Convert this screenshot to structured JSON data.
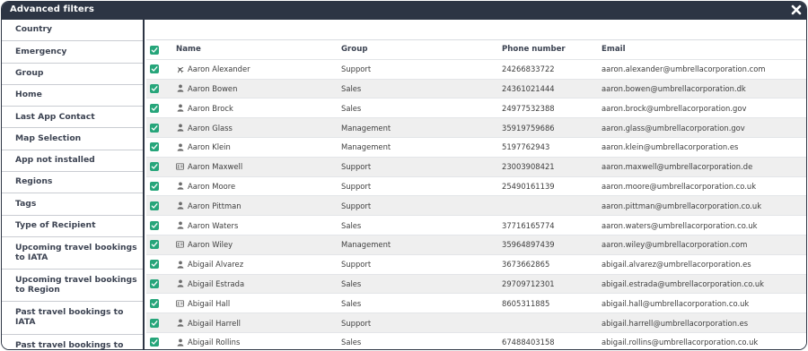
{
  "window": {
    "title": "Advanced filters"
  },
  "sidebar": {
    "items": [
      {
        "label": "Country"
      },
      {
        "label": "Emergency"
      },
      {
        "label": "Group"
      },
      {
        "label": "Home"
      },
      {
        "label": "Last App Contact"
      },
      {
        "label": "Map Selection"
      },
      {
        "label": "App not installed"
      },
      {
        "label": "Regions"
      },
      {
        "label": "Tags"
      },
      {
        "label": "Type of Recipient"
      },
      {
        "label": "Upcoming travel bookings to IATA"
      },
      {
        "label": "Upcoming travel bookings to Region"
      },
      {
        "label": "Past travel bookings to IATA"
      },
      {
        "label": "Past travel bookings to Region"
      }
    ]
  },
  "table": {
    "headers": {
      "name": "Name",
      "group": "Group",
      "phone": "Phone number",
      "email": "Email"
    },
    "rows": [
      {
        "icon": "plane-icon",
        "name": "Aaron Alexander",
        "group": "Support",
        "phone": "24266833722",
        "email": "aaron.alexander@umbrellacorporation.com"
      },
      {
        "icon": "person-icon",
        "name": "Aaron Bowen",
        "group": "Sales",
        "phone": "24361021444",
        "email": "aaron.bowen@umbrellacorporation.dk"
      },
      {
        "icon": "person-icon",
        "name": "Aaron Brock",
        "group": "Sales",
        "phone": "24977532388",
        "email": "aaron.brock@umbrellacorporation.gov"
      },
      {
        "icon": "person-icon",
        "name": "Aaron Glass",
        "group": "Management",
        "phone": "35919759686",
        "email": "aaron.glass@umbrellacorporation.gov"
      },
      {
        "icon": "person-icon",
        "name": "Aaron Klein",
        "group": "Management",
        "phone": "5197762943",
        "email": "aaron.klein@umbrellacorporation.es"
      },
      {
        "icon": "id-card-icon",
        "name": "Aaron Maxwell",
        "group": "Support",
        "phone": "23003908421",
        "email": "aaron.maxwell@umbrellacorporation.de"
      },
      {
        "icon": "person-icon",
        "name": "Aaron Moore",
        "group": "Support",
        "phone": "25490161139",
        "email": "aaron.moore@umbrellacorporation.co.uk"
      },
      {
        "icon": "person-icon",
        "name": "Aaron Pittman",
        "group": "Support",
        "phone": "",
        "email": "aaron.pittman@umbrellacorporation.co.uk"
      },
      {
        "icon": "person-icon",
        "name": "Aaron Waters",
        "group": "Sales",
        "phone": "37716165774",
        "email": "aaron.waters@umbrellacorporation.co.uk"
      },
      {
        "icon": "id-card-icon",
        "name": "Aaron Wiley",
        "group": "Management",
        "phone": "35964897439",
        "email": "aaron.wiley@umbrellacorporation.com"
      },
      {
        "icon": "person-icon",
        "name": "Abigail Alvarez",
        "group": "Support",
        "phone": "3673662865",
        "email": "abigail.alvarez@umbrellacorporation.es"
      },
      {
        "icon": "person-icon",
        "name": "Abigail Estrada",
        "group": "Sales",
        "phone": "29709712301",
        "email": "abigail.estrada@umbrellacorporation.co.uk"
      },
      {
        "icon": "id-card-icon",
        "name": "Abigail Hall",
        "group": "Sales",
        "phone": "8605311885",
        "email": "abigail.hall@umbrellacorporation.co.uk"
      },
      {
        "icon": "person-icon",
        "name": "Abigail Harrell",
        "group": "Support",
        "phone": "",
        "email": "abigail.harrell@umbrellacorporation.es"
      },
      {
        "icon": "person-icon",
        "name": "Abigail Rollins",
        "group": "Sales",
        "phone": "67488403158",
        "email": "abigail.rollins@umbrellacorporation.co.uk"
      }
    ]
  },
  "colors": {
    "titlebar": "#2d3544",
    "checkbox": "#26a57a",
    "row_alt": "#efefef"
  }
}
